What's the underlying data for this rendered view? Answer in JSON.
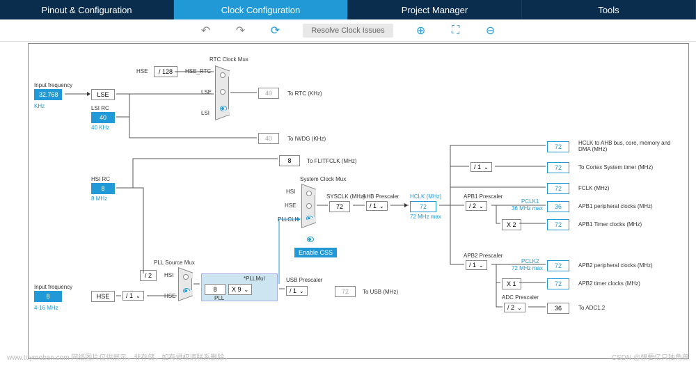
{
  "tabs": [
    "Pinout & Configuration",
    "Clock Configuration",
    "Project Manager",
    "Tools"
  ],
  "toolbar": {
    "resolve": "Resolve Clock Issues"
  },
  "labels": {
    "input_freq": "Input frequency",
    "khz": "KHz",
    "lse": "LSE",
    "lsi_rc": "LSI RC",
    "lsi_khz": "40 KHz",
    "hsi_rc": "HSI RC",
    "hsi_mhz": "8 MHz",
    "hse": "HSE",
    "hse_range": "4-16 MHz",
    "rtc_mux": "RTC Clock Mux",
    "hse_l": "HSE",
    "div128": "/ 128",
    "hse_rtc": "HSE_RTC",
    "lse_l": "LSE",
    "lsi_l": "LSI",
    "to_rtc": "To RTC (KHz)",
    "to_iwdg": "To IWDG (KHz)",
    "to_flitfclk": "To FLITFCLK (MHz)",
    "sys_mux": "System Clock Mux",
    "hsi_l": "HSI",
    "pllclk": "PLLCLK",
    "enable_css": "Enable CSS",
    "pll_src": "PLL Source Mux",
    "div2": "/ 2",
    "pllmul": "*PLLMul",
    "pll": "PLL",
    "usb_pre": "USB Prescaler",
    "to_usb": "To USB (MHz)",
    "sysclk": "SYSCLK (MHz)",
    "ahb_pre": "AHB Prescaler",
    "hclk": "HCLK (MHz)",
    "hclk_max": "72 MHz max",
    "hclk_ahb": "HCLK to AHB bus, core, memory and DMA (MHz)",
    "cortex": "To Cortex System timer (MHz)",
    "fclk": "FCLK (MHz)",
    "apb1_pre": "APB1 Prescaler",
    "pclk1": "PCLK1",
    "pclk1_max": "36 MHz max",
    "apb1_periph": "APB1 peripheral clocks (MHz)",
    "apb1_timer": "APB1 Timer clocks (MHz)",
    "apb2_pre": "APB2 Prescaler",
    "pclk2": "PCLK2",
    "pclk2_max": "72 MHz max",
    "apb2_periph": "APB2 peripheral clocks (MHz)",
    "apb2_timer": "APB2 timer clocks (MHz)",
    "adc_pre": "ADC Prescaler",
    "to_adc": "To ADC1,2"
  },
  "values": {
    "lse_in": "32.768",
    "lsi": "40",
    "rtc": "40",
    "iwdg": "40",
    "hsi": "8",
    "hse_in": "8",
    "flitfclk": "8",
    "pll_in": "8",
    "pllmul": "X 9",
    "hse_div": "/ 1",
    "usb_div": "/ 1",
    "usb": "72",
    "sysclk": "72",
    "ahb_div": "/ 1",
    "hclk": "72",
    "hclk_ahb": "72",
    "cortex_div": "/ 1",
    "cortex": "72",
    "fclk": "72",
    "apb1_div": "/ 2",
    "x2": "X 2",
    "pclk1": "36",
    "apb1_timer": "72",
    "apb2_div": "/ 1",
    "x1": "X 1",
    "pclk2": "72",
    "apb2_timer": "72",
    "adc_div": "/ 2",
    "adc": "36"
  },
  "watermark": {
    "left": "www.toymoban.com 网络图片仅供展示，非存储，如有侵权请联系删除。",
    "right": "CSDN @想要亿只独角兽"
  }
}
